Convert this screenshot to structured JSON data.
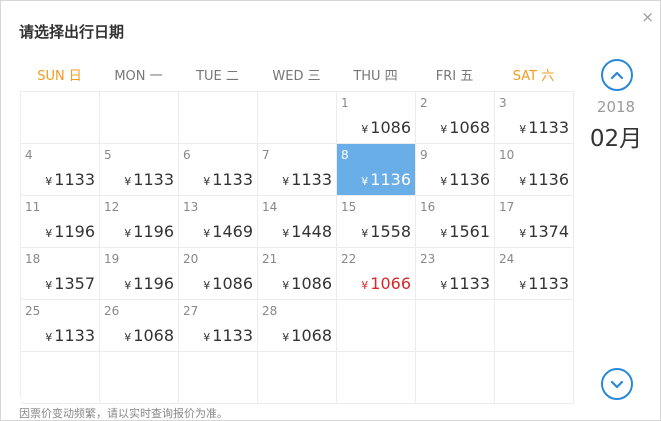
{
  "title": "请选择出行日期",
  "close_label": "×",
  "weekdays": [
    "SUN 日",
    "MON 一",
    "TUE 二",
    "WED 三",
    "THU 四",
    "FRI 五",
    "SAT 六"
  ],
  "colors": {
    "weekend": "#f39a1f",
    "selected_bg": "#6aaee8",
    "lowest_price": "#d42a2a",
    "nav_accent": "#2a88d8"
  },
  "currency_symbol": "¥",
  "year": "2018",
  "month": "02月",
  "selected_day": 8,
  "lowest_day": 22,
  "days": [
    {
      "day": "1",
      "price": "1086"
    },
    {
      "day": "2",
      "price": "1068"
    },
    {
      "day": "3",
      "price": "1133"
    },
    {
      "day": "4",
      "price": "1133"
    },
    {
      "day": "5",
      "price": "1133"
    },
    {
      "day": "6",
      "price": "1133"
    },
    {
      "day": "7",
      "price": "1133"
    },
    {
      "day": "8",
      "price": "1136"
    },
    {
      "day": "9",
      "price": "1136"
    },
    {
      "day": "10",
      "price": "1136"
    },
    {
      "day": "11",
      "price": "1196"
    },
    {
      "day": "12",
      "price": "1196"
    },
    {
      "day": "13",
      "price": "1469"
    },
    {
      "day": "14",
      "price": "1448"
    },
    {
      "day": "15",
      "price": "1558"
    },
    {
      "day": "16",
      "price": "1561"
    },
    {
      "day": "17",
      "price": "1374"
    },
    {
      "day": "18",
      "price": "1357"
    },
    {
      "day": "19",
      "price": "1196"
    },
    {
      "day": "20",
      "price": "1086"
    },
    {
      "day": "21",
      "price": "1086"
    },
    {
      "day": "22",
      "price": "1066"
    },
    {
      "day": "23",
      "price": "1133"
    },
    {
      "day": "24",
      "price": "1133"
    },
    {
      "day": "25",
      "price": "1133"
    },
    {
      "day": "26",
      "price": "1068"
    },
    {
      "day": "27",
      "price": "1133"
    },
    {
      "day": "28",
      "price": "1068"
    }
  ],
  "note": "因票价变动频繁，请以实时查询报价为准。",
  "icons": {
    "prev": "chevron-up-icon",
    "next": "chevron-down-icon"
  }
}
